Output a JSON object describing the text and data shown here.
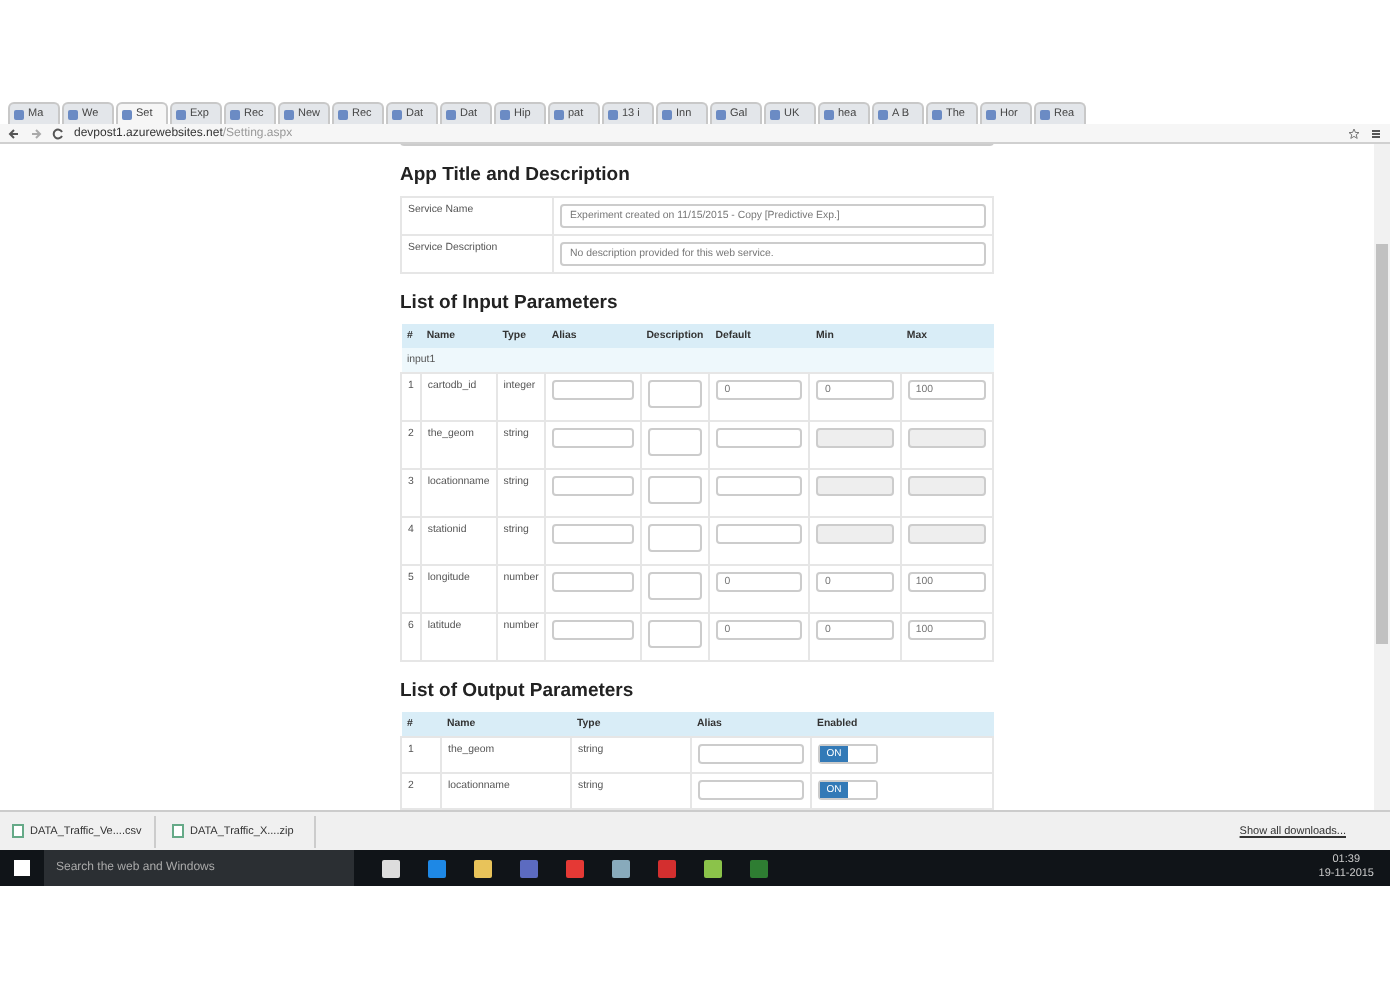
{
  "browser": {
    "tabs": [
      {
        "label": "Ma",
        "selected": false
      },
      {
        "label": "We",
        "selected": false
      },
      {
        "label": "Set",
        "selected": true
      },
      {
        "label": "Exp",
        "selected": false
      },
      {
        "label": "Rec",
        "selected": false
      },
      {
        "label": "New",
        "selected": false
      },
      {
        "label": "Rec",
        "selected": false
      },
      {
        "label": "Dat",
        "selected": false
      },
      {
        "label": "Dat",
        "selected": false
      },
      {
        "label": "Hip",
        "selected": false
      },
      {
        "label": "pat",
        "selected": false
      },
      {
        "label": "13 i",
        "selected": false
      },
      {
        "label": "Inn",
        "selected": false
      },
      {
        "label": "Gal",
        "selected": false
      },
      {
        "label": "UK",
        "selected": false
      },
      {
        "label": "hea",
        "selected": false
      },
      {
        "label": "A B",
        "selected": false
      },
      {
        "label": "The",
        "selected": false
      },
      {
        "label": "Hor",
        "selected": false
      },
      {
        "label": "Rea",
        "selected": false
      }
    ],
    "url_host": "devpost1.azurewebsites.net",
    "url_path": "/Setting.aspx"
  },
  "app_title": {
    "heading": "App Title and Description",
    "fields": [
      {
        "label": "Service Name",
        "value": "Experiment created on 11/15/2015 - Copy [Predictive Exp.]"
      },
      {
        "label": "Service Description",
        "value": "No description provided for this web service."
      }
    ]
  },
  "input_parameters": {
    "heading": "List of Input Parameters",
    "columns": [
      "#",
      "Name",
      "Type",
      "Alias",
      "Description",
      "Default",
      "Min",
      "Max"
    ],
    "group": "input1",
    "rows": [
      {
        "index": "1",
        "name": "cartodb_id",
        "type": "integer",
        "default": "0",
        "min": "0",
        "max": "100",
        "disabled": false
      },
      {
        "index": "2",
        "name": "the_geom",
        "type": "string",
        "default": "",
        "min": "",
        "max": "",
        "disabled": true
      },
      {
        "index": "3",
        "name": "locationname",
        "type": "string",
        "default": "",
        "min": "",
        "max": "",
        "disabled": true
      },
      {
        "index": "4",
        "name": "stationid",
        "type": "string",
        "default": "",
        "min": "",
        "max": "",
        "disabled": true
      },
      {
        "index": "5",
        "name": "longitude",
        "type": "number",
        "default": "0",
        "min": "0",
        "max": "100",
        "disabled": false
      },
      {
        "index": "6",
        "name": "latitude",
        "type": "number",
        "default": "0",
        "min": "0",
        "max": "100",
        "disabled": false
      }
    ]
  },
  "output_parameters": {
    "heading": "List of Output Parameters",
    "columns": [
      "#",
      "Name",
      "Type",
      "Alias",
      "Enabled"
    ],
    "rows": [
      {
        "index": "1",
        "name": "the_geom",
        "type": "string",
        "toggle": "ON",
        "on": true
      },
      {
        "index": "2",
        "name": "locationname",
        "type": "string",
        "toggle": "ON",
        "on": true
      }
    ]
  },
  "downloads": {
    "items": [
      "DATA_Traffic_Ve....csv",
      "DATA_Traffic_X....zip"
    ],
    "show_all": "Show all downloads..."
  },
  "taskbar": {
    "search_placeholder": "Search the web and Windows",
    "time": "01:39",
    "date": "19-11-2015"
  }
}
